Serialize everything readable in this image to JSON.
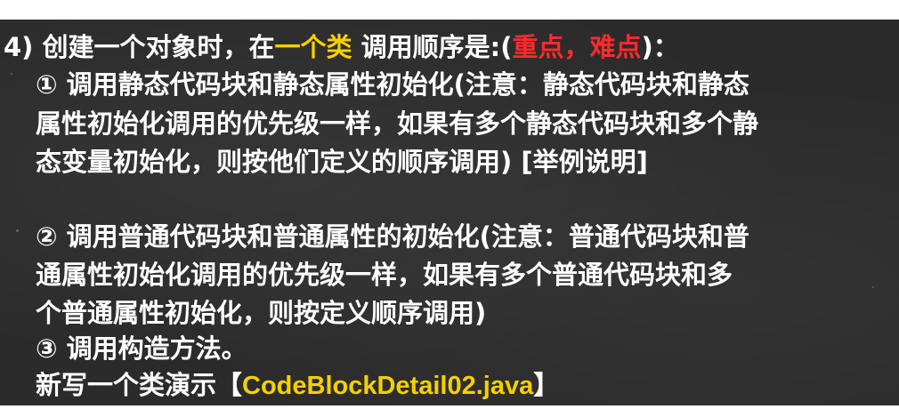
{
  "point": {
    "line1": {
      "prefix": "4) 创建一个对象时，在",
      "highlight": "一个类",
      "middle": " 调用顺序是:(",
      "emphasis": "重点，难点",
      "suffix": ")："
    },
    "item1": {
      "line_a": "① 调用静态代码块和静态属性初始化(注意：静态代码块和静态",
      "line_b": "属性初始化调用的优先级一样，如果有多个静态代码块和多个静",
      "line_c": "态变量初始化，则按他们定义的顺序调用) [举例说明]"
    },
    "item2": {
      "line_a": "② 调用普通代码块和普通属性的初始化(注意：普通代码块和普",
      "line_b": "通属性初始化调用的优先级一样，如果有多个普通代码块和多",
      "line_c": "个普通属性初始化，则按定义顺序调用)"
    },
    "item3": "③ 调用构造方法。",
    "demo": {
      "prefix": "新写一个类演示【",
      "file": "CodeBlockDetail02.java",
      "suffix": "】"
    }
  },
  "colors": {
    "background": "#2b2b2b",
    "text": "#ffffff",
    "yellow_highlight": "#f5d000",
    "red_highlight": "#ff2a2a"
  }
}
